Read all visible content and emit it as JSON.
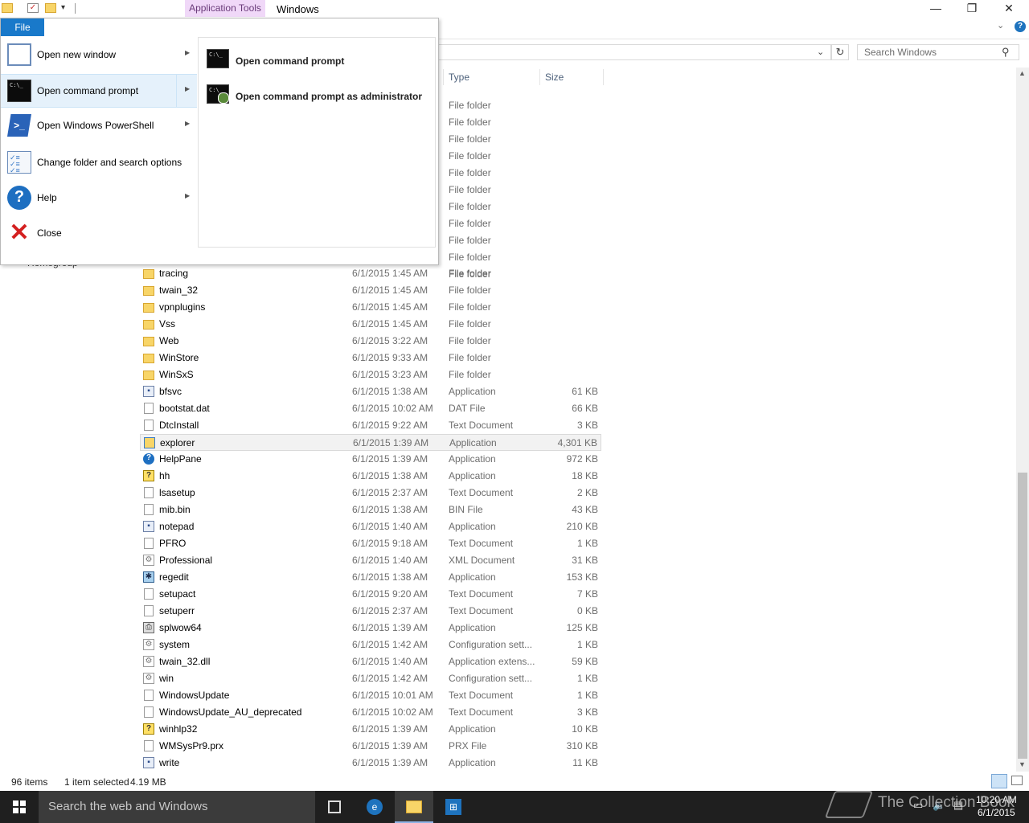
{
  "window": {
    "title": "Windows",
    "contextual_tab": "Application Tools",
    "minimize_glyph": "—",
    "maximize_glyph": "❐",
    "close_glyph": "✕"
  },
  "ribbon": {
    "file_tab": "File",
    "help_glyph": "?",
    "collapse_glyph": "⌄"
  },
  "address": {
    "dropdown_glyph": "⌄",
    "refresh_glyph": "↻"
  },
  "search": {
    "placeholder": "Search Windows",
    "icon_glyph": "⚲"
  },
  "columns": {
    "type": "Type",
    "size": "Size"
  },
  "file_menu": {
    "items": [
      {
        "label": "Open new window",
        "icon": "new-window-icon",
        "has_submenu": true
      },
      {
        "label": "Open command prompt",
        "icon": "command-prompt-icon",
        "has_submenu": true
      },
      {
        "label": "Open Windows PowerShell",
        "icon": "powershell-icon",
        "has_submenu": true
      },
      {
        "label": "Change folder and search options",
        "icon": "folder-options-icon",
        "has_submenu": false
      },
      {
        "label": "Help",
        "icon": "help-icon",
        "has_submenu": true
      },
      {
        "label": "Close",
        "icon": "close-icon",
        "has_submenu": false
      }
    ],
    "submenu": [
      {
        "label": "Open command prompt",
        "icon": "command-prompt-icon"
      },
      {
        "label": "Open command prompt as administrator",
        "icon": "command-prompt-admin-icon"
      }
    ],
    "arrow_glyph": "▶",
    "cmd_glyph": "C:\\_",
    "ps_glyph": ">_",
    "help_glyph": "?",
    "close_glyph": "✕",
    "options_glyph": "✓≡\n✓≡\n✓≡"
  },
  "partial_rows_type": [
    "File folder",
    "File folder",
    "File folder",
    "File folder",
    "File folder",
    "File folder",
    "File folder",
    "File folder",
    "File folder",
    "File folder",
    "File folder"
  ],
  "hidden_nav_fragment": "Homegroup",
  "files": [
    {
      "name": "tracing",
      "date": "6/1/2015 1:45 AM",
      "type": "File folder",
      "size": "",
      "icon": "folder"
    },
    {
      "name": "twain_32",
      "date": "6/1/2015 1:45 AM",
      "type": "File folder",
      "size": "",
      "icon": "folder"
    },
    {
      "name": "vpnplugins",
      "date": "6/1/2015 1:45 AM",
      "type": "File folder",
      "size": "",
      "icon": "folder"
    },
    {
      "name": "Vss",
      "date": "6/1/2015 1:45 AM",
      "type": "File folder",
      "size": "",
      "icon": "folder"
    },
    {
      "name": "Web",
      "date": "6/1/2015 3:22 AM",
      "type": "File folder",
      "size": "",
      "icon": "folder"
    },
    {
      "name": "WinStore",
      "date": "6/1/2015 9:33 AM",
      "type": "File folder",
      "size": "",
      "icon": "folder"
    },
    {
      "name": "WinSxS",
      "date": "6/1/2015 3:23 AM",
      "type": "File folder",
      "size": "",
      "icon": "folder"
    },
    {
      "name": "bfsvc",
      "date": "6/1/2015 1:38 AM",
      "type": "Application",
      "size": "61 KB",
      "icon": "app"
    },
    {
      "name": "bootstat.dat",
      "date": "6/1/2015 10:02 AM",
      "type": "DAT File",
      "size": "66 KB",
      "icon": "doc"
    },
    {
      "name": "DtcInstall",
      "date": "6/1/2015 9:22 AM",
      "type": "Text Document",
      "size": "3 KB",
      "icon": "doc"
    },
    {
      "name": "explorer",
      "date": "6/1/2015 1:39 AM",
      "type": "Application",
      "size": "4,301 KB",
      "icon": "explorer",
      "selected": true
    },
    {
      "name": "HelpPane",
      "date": "6/1/2015 1:39 AM",
      "type": "Application",
      "size": "972 KB",
      "icon": "help"
    },
    {
      "name": "hh",
      "date": "6/1/2015 1:38 AM",
      "type": "Application",
      "size": "18 KB",
      "icon": "hh"
    },
    {
      "name": "lsasetup",
      "date": "6/1/2015 2:37 AM",
      "type": "Text Document",
      "size": "2 KB",
      "icon": "doc"
    },
    {
      "name": "mib.bin",
      "date": "6/1/2015 1:38 AM",
      "type": "BIN File",
      "size": "43 KB",
      "icon": "doc"
    },
    {
      "name": "notepad",
      "date": "6/1/2015 1:40 AM",
      "type": "Application",
      "size": "210 KB",
      "icon": "app"
    },
    {
      "name": "PFRO",
      "date": "6/1/2015 9:18 AM",
      "type": "Text Document",
      "size": "1 KB",
      "icon": "doc"
    },
    {
      "name": "Professional",
      "date": "6/1/2015 1:40 AM",
      "type": "XML Document",
      "size": "31 KB",
      "icon": "cfg"
    },
    {
      "name": "regedit",
      "date": "6/1/2015 1:38 AM",
      "type": "Application",
      "size": "153 KB",
      "icon": "reg"
    },
    {
      "name": "setupact",
      "date": "6/1/2015 9:20 AM",
      "type": "Text Document",
      "size": "7 KB",
      "icon": "doc"
    },
    {
      "name": "setuperr",
      "date": "6/1/2015 2:37 AM",
      "type": "Text Document",
      "size": "0 KB",
      "icon": "doc"
    },
    {
      "name": "splwow64",
      "date": "6/1/2015 1:39 AM",
      "type": "Application",
      "size": "125 KB",
      "icon": "print"
    },
    {
      "name": "system",
      "date": "6/1/2015 1:42 AM",
      "type": "Configuration sett...",
      "size": "1 KB",
      "icon": "cfg"
    },
    {
      "name": "twain_32.dll",
      "date": "6/1/2015 1:40 AM",
      "type": "Application extens...",
      "size": "59 KB",
      "icon": "cfg"
    },
    {
      "name": "win",
      "date": "6/1/2015 1:42 AM",
      "type": "Configuration sett...",
      "size": "1 KB",
      "icon": "cfg"
    },
    {
      "name": "WindowsUpdate",
      "date": "6/1/2015 10:01 AM",
      "type": "Text Document",
      "size": "1 KB",
      "icon": "doc"
    },
    {
      "name": "WindowsUpdate_AU_deprecated",
      "date": "6/1/2015 10:02 AM",
      "type": "Text Document",
      "size": "3 KB",
      "icon": "doc"
    },
    {
      "name": "winhlp32",
      "date": "6/1/2015 1:39 AM",
      "type": "Application",
      "size": "10 KB",
      "icon": "hh"
    },
    {
      "name": "WMSysPr9.prx",
      "date": "6/1/2015 1:39 AM",
      "type": "PRX File",
      "size": "310 KB",
      "icon": "doc"
    },
    {
      "name": "write",
      "date": "6/1/2015 1:39 AM",
      "type": "Application",
      "size": "11 KB",
      "icon": "app"
    }
  ],
  "status": {
    "item_count": "96 items",
    "selection": "1 item selected",
    "selection_size": "4.19 MB"
  },
  "taskbar": {
    "search_placeholder": "Search the web and Windows",
    "time": "10:20 AM",
    "date": "6/1/2015",
    "ie_glyph": "e",
    "store_glyph": "⊞"
  },
  "watermark": "The Collection Book",
  "colors": {
    "accent": "#1979ca",
    "contextual_tab_bg": "#f0d8f8",
    "taskbar": "#1f1f1f"
  }
}
